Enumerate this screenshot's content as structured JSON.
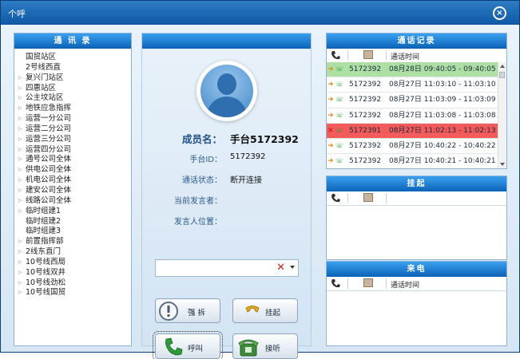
{
  "window": {
    "title": "个呼"
  },
  "contacts": {
    "header": "通 讯 录",
    "items": [
      {
        "label": "国贸站区",
        "expandable": false
      },
      {
        "label": "2号线西直",
        "expandable": false
      },
      {
        "label": "复兴门站区",
        "expandable": true
      },
      {
        "label": "四惠站区",
        "expandable": true
      },
      {
        "label": "公主坟站区",
        "expandable": true
      },
      {
        "label": "地铁应急指挥",
        "expandable": true
      },
      {
        "label": "运营一分公司",
        "expandable": true
      },
      {
        "label": "运营二分公司",
        "expandable": true
      },
      {
        "label": "运营三分公司",
        "expandable": true
      },
      {
        "label": "运营四分公司",
        "expandable": true
      },
      {
        "label": "通号公司全体",
        "expandable": true
      },
      {
        "label": "供电公司全体",
        "expandable": true
      },
      {
        "label": "机电公司全体",
        "expandable": true
      },
      {
        "label": "建安公司全体",
        "expandable": true
      },
      {
        "label": "线路公司全体",
        "expandable": true
      },
      {
        "label": "临时组建1",
        "expandable": true
      },
      {
        "label": "临时组建2",
        "expandable": false
      },
      {
        "label": "临时组建3",
        "expandable": false
      },
      {
        "label": "前置指挥部",
        "expandable": true
      },
      {
        "label": "2线东直门",
        "expandable": true
      },
      {
        "label": "10号线西局",
        "expandable": true
      },
      {
        "label": "10号线双井",
        "expandable": true
      },
      {
        "label": "10号线劲松",
        "expandable": true
      },
      {
        "label": "10号线国贸",
        "expandable": true
      }
    ]
  },
  "member": {
    "name_label": "成员名：",
    "name_value": "手台5172392",
    "id_label": "手台ID：",
    "id_value": "5172392",
    "status_label": "通话状态：",
    "status_value": "断开连接",
    "speaker_label": "当前发言者：",
    "speaker_value": "",
    "location_label": "发言人位置：",
    "location_value": ""
  },
  "buttons": {
    "force_break": "强 拆",
    "hangup": "挂起",
    "call": "呼叫",
    "answer": "接听"
  },
  "records": {
    "header": "通话记录",
    "col_time": "通话时间",
    "rows": [
      {
        "num": "5172392",
        "time": "08月28日 09:40:05 - 09:40:05",
        "state": "green"
      },
      {
        "num": "5172392",
        "time": "08月27日 11:03:10 - 11:03:10",
        "state": "normal"
      },
      {
        "num": "5172392",
        "time": "08月27日 11:03:09 - 11:03:09",
        "state": "normal"
      },
      {
        "num": "5172392",
        "time": "08月27日 11:03:08 - 11:03:08",
        "state": "normal"
      },
      {
        "num": "5172391",
        "time": "08月27日 11:02:13 - 11:02:13",
        "state": "red"
      },
      {
        "num": "5172392",
        "time": "08月27日 10:40:22 - 10:40:22",
        "state": "normal"
      },
      {
        "num": "5172392",
        "time": "08月27日 10:40:21 - 10:40:21",
        "state": "normal"
      }
    ]
  },
  "hold": {
    "header": "挂起"
  },
  "incoming": {
    "header": "来电",
    "col_time": "通话时间"
  },
  "colors": {
    "accent": "#0b62b8",
    "row_green": "#aee0a6",
    "row_red": "#f35a5a",
    "clear_red": "#d02020"
  }
}
